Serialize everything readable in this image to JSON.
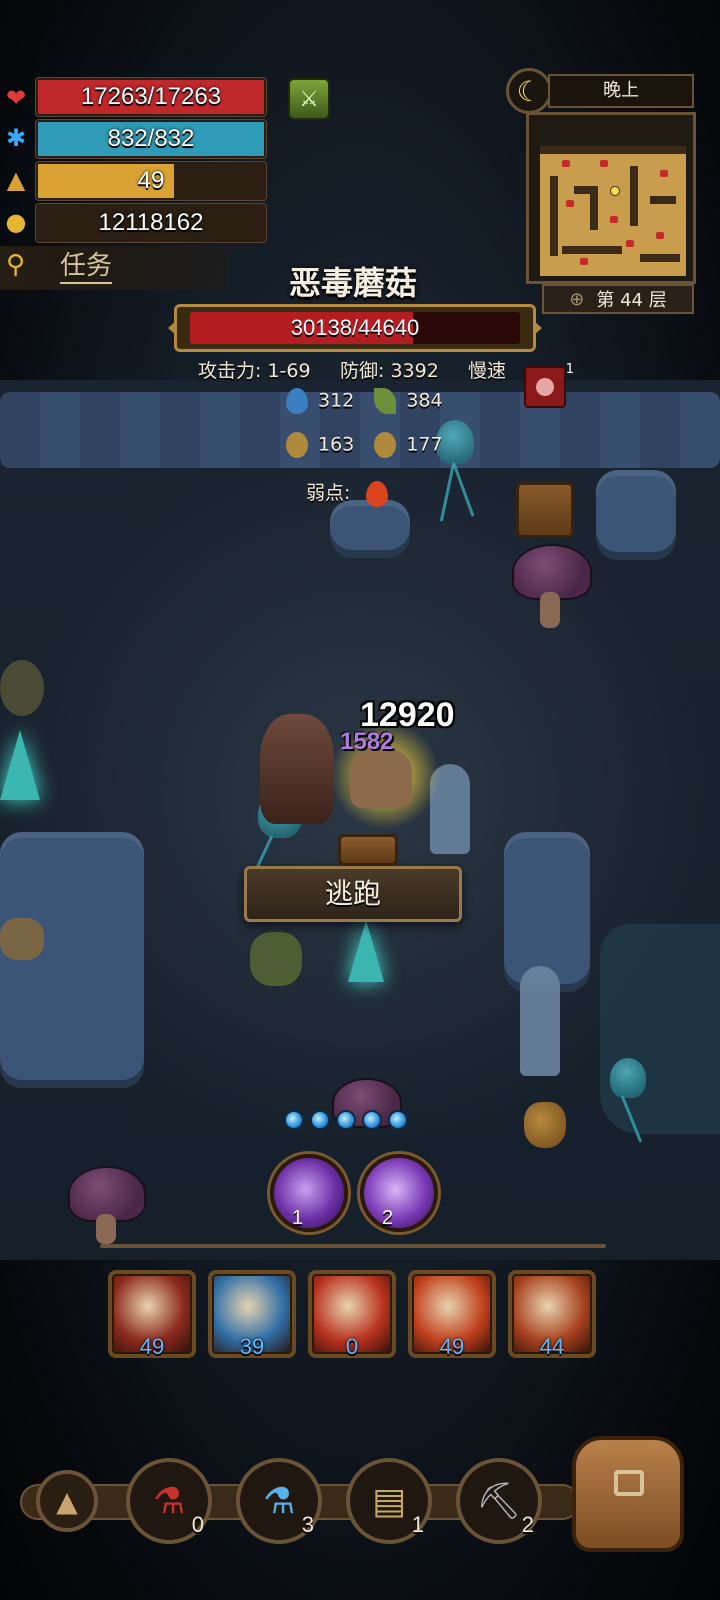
{
  "player": {
    "hp": "17263/17263",
    "hp_fraction": 1.0,
    "mp": "832/832",
    "mp_fraction": 1.0,
    "level": "49",
    "level_fraction": 0.6,
    "gold": "12118162",
    "quest_label": "任务",
    "icons": {
      "hp": "heart-icon",
      "mp": "mana-spark-icon",
      "level": "triangle-icon",
      "gold": "gold-coins-icon",
      "quest": "magnifier-icon"
    }
  },
  "time_of_day": "晚上",
  "floor": "第 44 层",
  "enemy": {
    "name": "恶毒蘑菇",
    "hp": "30138/44640",
    "hp_fraction": 0.675,
    "attack": "攻击力: 1-69",
    "defense": "防御: 3392",
    "speed": "慢速",
    "resist_water_1": "312",
    "resist_nature_1": "384",
    "resist_water_2": "163",
    "resist_nature_2": "177",
    "weakness_label": "弱点:",
    "status_stack": "1"
  },
  "combat": {
    "damage_main": "12920",
    "damage_sub": "1582",
    "flee_label": "逃跑"
  },
  "mana_orbs": 5,
  "spells": [
    {
      "count": "1"
    },
    {
      "count": "2"
    }
  ],
  "skills": [
    {
      "count": "49",
      "color": "#8c2a1e"
    },
    {
      "count": "39",
      "color": "#2f6fa6"
    },
    {
      "count": "0",
      "color": "#b8321e"
    },
    {
      "count": "49",
      "color": "#c0401c"
    },
    {
      "count": "44",
      "color": "#a8421e"
    }
  ],
  "items": [
    {
      "count": "0",
      "icon": "red-potion-icon"
    },
    {
      "count": "3",
      "icon": "blue-potion-icon"
    },
    {
      "count": "1",
      "icon": "map-scroll-icon"
    },
    {
      "count": "2",
      "icon": "pickaxe-icon"
    }
  ],
  "colors": {
    "hp": "#c0282a",
    "mp": "#2f9bb8",
    "level": "#d9a233",
    "enemy_hp": "#b41e22"
  }
}
